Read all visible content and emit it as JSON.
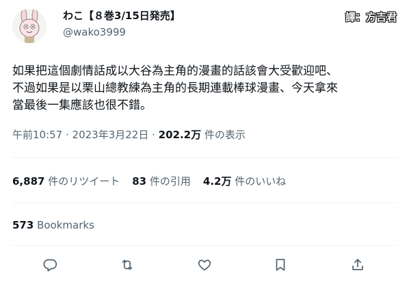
{
  "author": {
    "display_name": "わこ【８巻3/15日発売】",
    "handle": "@wako3999"
  },
  "watermark": "譯：方吉君",
  "tweet": {
    "lines": [
      "如果把這個劇情話成以大谷為主角的漫畫的話該會大受歡迎吧、",
      "不過如果是以栗山總教練為主角的長期連載棒球漫畫、今天拿來",
      "當最後一集應該也很不錯。"
    ]
  },
  "meta": {
    "datetime": "午前10:57 · 2023年3月22日 · ",
    "views_count": "202.2万",
    "views_label": " 件の表示"
  },
  "stats": {
    "retweets": {
      "count": "6,887",
      "label": "件のリツイート"
    },
    "quotes": {
      "count": "83",
      "label": "件の引用"
    },
    "likes": {
      "count": "4.2万",
      "label": "件のいいね"
    }
  },
  "bookmarks": {
    "count": "573",
    "label": "Bookmarks"
  },
  "actions": {
    "reply_icon": "reply-icon",
    "retweet_icon": "retweet-icon",
    "like_icon": "like-icon",
    "bookmark_icon": "bookmark-icon",
    "share_icon": "share-icon"
  },
  "colors": {
    "text": "#0f1419",
    "secondary": "#536471",
    "divider": "#eff3f4"
  }
}
